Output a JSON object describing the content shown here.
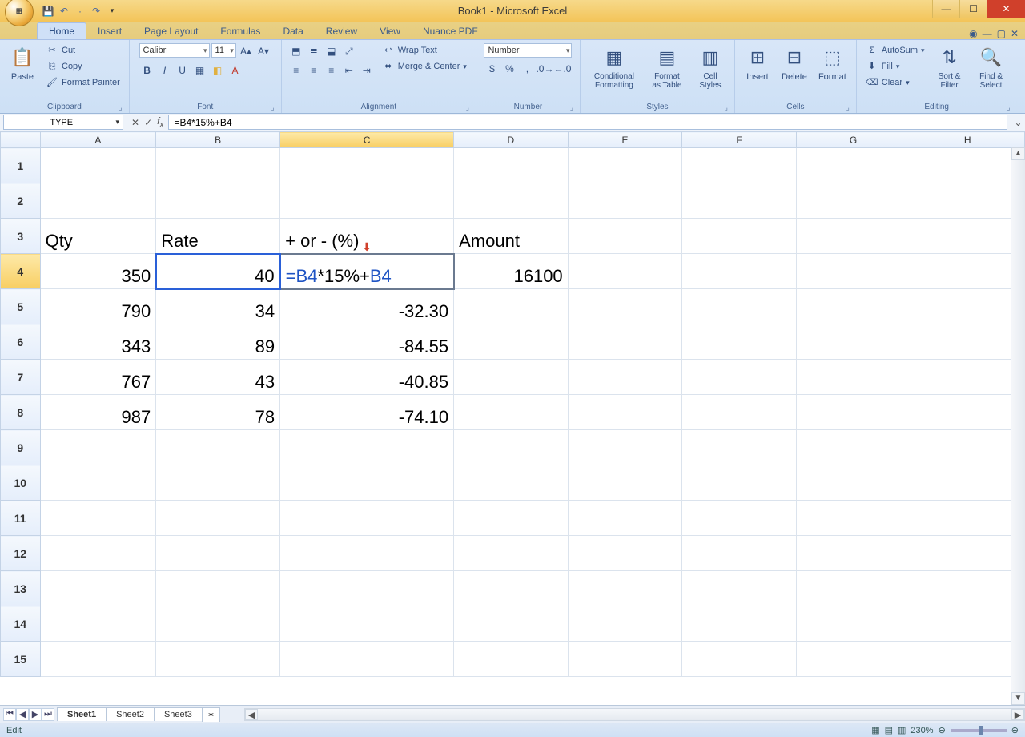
{
  "title": "Book1 - Microsoft Excel",
  "qat": {
    "save": "💾",
    "undo": "↶",
    "redo": "↷"
  },
  "tabs": [
    "Home",
    "Insert",
    "Page Layout",
    "Formulas",
    "Data",
    "Review",
    "View",
    "Nuance PDF"
  ],
  "active_tab": "Home",
  "ribbon": {
    "clipboard": {
      "paste": "Paste",
      "cut": "Cut",
      "copy": "Copy",
      "fp": "Format Painter",
      "label": "Clipboard"
    },
    "font": {
      "name": "Calibri",
      "size": "11",
      "label": "Font"
    },
    "alignment": {
      "wrap": "Wrap Text",
      "merge": "Merge & Center",
      "label": "Alignment"
    },
    "number": {
      "format": "Number",
      "label": "Number"
    },
    "styles": {
      "cf": "Conditional Formatting",
      "fat": "Format as Table",
      "cs": "Cell Styles",
      "label": "Styles"
    },
    "cells": {
      "ins": "Insert",
      "del": "Delete",
      "fmt": "Format",
      "label": "Cells"
    },
    "editing": {
      "sum": "AutoSum",
      "fill": "Fill",
      "clear": "Clear",
      "sort": "Sort & Filter",
      "find": "Find & Select",
      "label": "Editing"
    }
  },
  "namebox": "TYPE",
  "formula": "=B4*15%+B4",
  "formula_parts": {
    "p1": "=B4",
    "p2": "*15%+",
    "p3": "B4"
  },
  "columns": [
    "A",
    "B",
    "C",
    "D",
    "E",
    "F",
    "G",
    "H"
  ],
  "rows_count": 15,
  "headers": {
    "A3": "Qty",
    "B3": "Rate",
    "C3": "+ or - (%)",
    "D3": "Amount"
  },
  "data": {
    "r4": {
      "A": "350",
      "B": "40",
      "C_formula": "=B4*15%+B4",
      "D": "16100"
    },
    "r5": {
      "A": "790",
      "B": "34",
      "C": "-32.30"
    },
    "r6": {
      "A": "343",
      "B": "89",
      "C": "-84.55"
    },
    "r7": {
      "A": "767",
      "B": "43",
      "C": "-40.85"
    },
    "r8": {
      "A": "987",
      "B": "78",
      "C": "-74.10"
    }
  },
  "sheets": [
    "Sheet1",
    "Sheet2",
    "Sheet3"
  ],
  "status": {
    "mode": "Edit",
    "zoom": "230%"
  }
}
